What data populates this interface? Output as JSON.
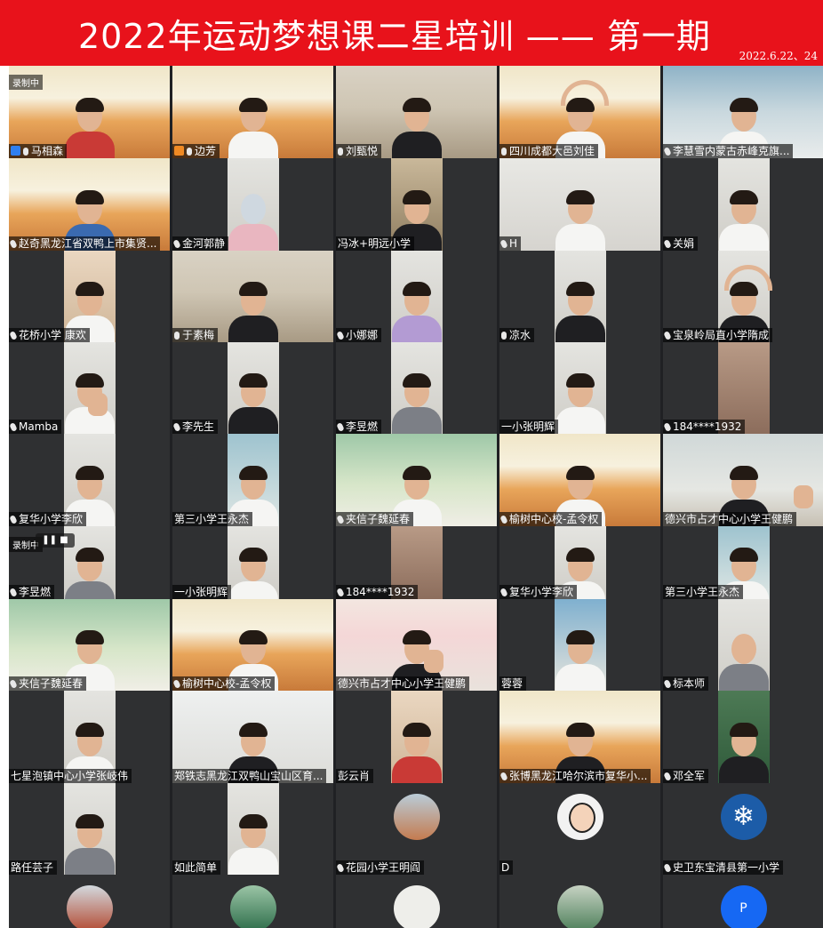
{
  "header": {
    "title": "2022年运动梦想课二星培训 —— 第一期",
    "date": "2022.6.22、24"
  },
  "recording": {
    "status_label": "录制中",
    "pause_icon": "pause-icon",
    "stop_icon": "stop-icon"
  },
  "participants": [
    {
      "name": "马相森",
      "host": true
    },
    {
      "name": "边芳",
      "host": true
    },
    {
      "name": "刘甄悦"
    },
    {
      "name": "四川成都大邑刘佳"
    },
    {
      "name": "李慧雪内蒙古赤峰克旗..."
    },
    {
      "name": "赵奇黑龙江省双鸭上市集贤..."
    },
    {
      "name": "金河郭静"
    },
    {
      "name": "冯冰+明远小学"
    },
    {
      "name": "H"
    },
    {
      "name": "关娟"
    },
    {
      "name": "花桥小学 康欢"
    },
    {
      "name": "于素梅"
    },
    {
      "name": "小娜娜"
    },
    {
      "name": "凉水"
    },
    {
      "name": "宝泉岭局直小学隋成"
    },
    {
      "name": "Mamba"
    },
    {
      "name": "李先生"
    },
    {
      "name": "李昱燃"
    },
    {
      "name": "一小张明辉"
    },
    {
      "name": "184****1932"
    },
    {
      "name": "复华小学李欣"
    },
    {
      "name": "第三小学王永杰"
    },
    {
      "name": "夹信子魏延春"
    },
    {
      "name": "榆树中心校-孟令权"
    },
    {
      "name": "德兴市占才中心小学王健鹏"
    },
    {
      "name": "李昱燃"
    },
    {
      "name": "一小张明辉"
    },
    {
      "name": "184****1932"
    },
    {
      "name": "复华小学李欣"
    },
    {
      "name": "第三小学王永杰"
    },
    {
      "name": "夹信子魏延春"
    },
    {
      "name": "榆树中心校-孟令权"
    },
    {
      "name": "德兴市占才中心小学王健鹏"
    },
    {
      "name": "蓉蓉"
    },
    {
      "name": "标本师"
    },
    {
      "name": "七星泡镇中心小学张岐伟"
    },
    {
      "name": "郑铁志黑龙江双鸭山宝山区育..."
    },
    {
      "name": "彭云肖"
    },
    {
      "name": "张博黑龙江哈尔滨市复华小..."
    },
    {
      "name": "邓全军"
    },
    {
      "name": "路任芸子"
    },
    {
      "name": "如此简单"
    },
    {
      "name": "花园小学王明阎"
    },
    {
      "name": "D"
    },
    {
      "name": "史卫东宝清县第一小学"
    },
    {
      "name": ""
    },
    {
      "name": ""
    },
    {
      "name": ""
    },
    {
      "name": ""
    },
    {
      "name": "",
      "avatar_letter": "P"
    }
  ],
  "colors": {
    "banner": "#e8121b",
    "grid_background": "#202124",
    "host_badge": "#2f7ff0",
    "avatar_p": "#1668f3"
  }
}
